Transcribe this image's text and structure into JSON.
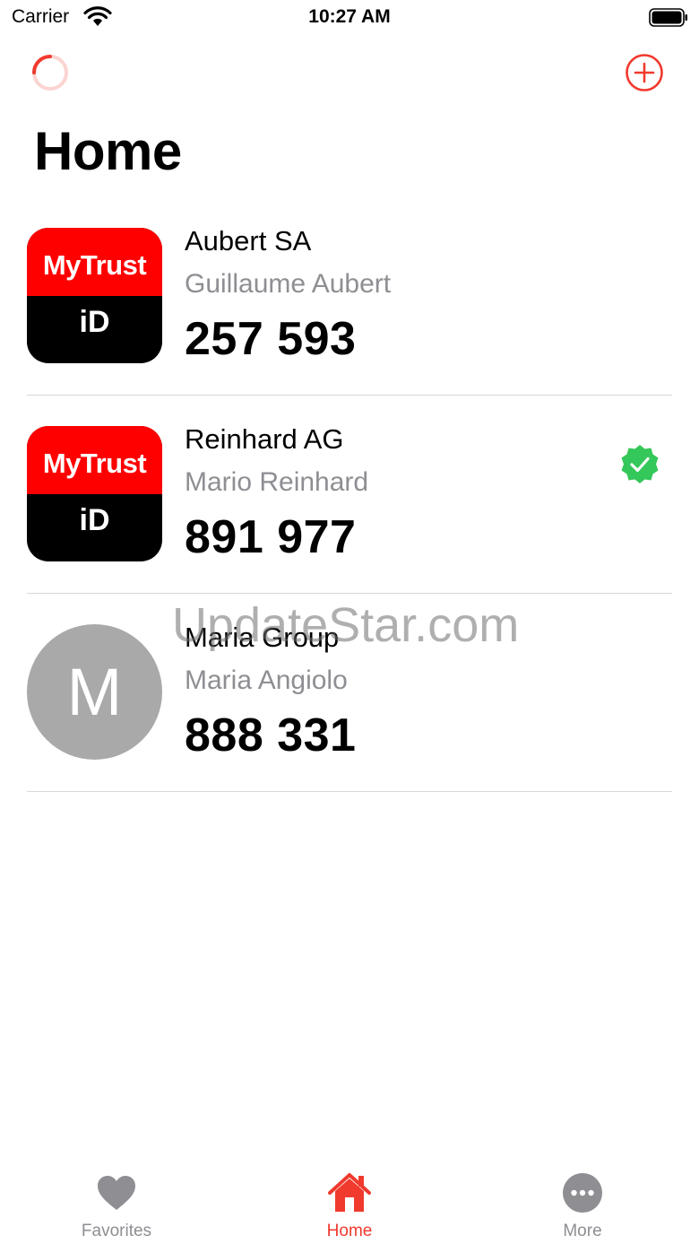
{
  "status_bar": {
    "carrier": "Carrier",
    "time": "10:27 AM"
  },
  "nav": {
    "title": "Home"
  },
  "accounts": [
    {
      "logo_brand": "MyTrust",
      "logo_id": "iD",
      "organization": "Aubert SA",
      "person": "Guillaume Aubert",
      "code": "257 593",
      "verified": false
    },
    {
      "logo_brand": "MyTrust",
      "logo_id": "iD",
      "organization": "Reinhard AG",
      "person": "Mario Reinhard",
      "code": "891 977",
      "verified": true
    },
    {
      "avatar_letter": "M",
      "organization": "Maria Group",
      "person": "Maria Angiolo",
      "code": "888 331",
      "verified": false
    }
  ],
  "watermark": "UpdateStar.com",
  "tabs": [
    {
      "label": "Favorites",
      "icon": "heart-icon",
      "active": false
    },
    {
      "label": "Home",
      "icon": "house-icon",
      "active": true
    },
    {
      "label": "More",
      "icon": "more-icon",
      "active": false
    }
  ],
  "colors": {
    "accent": "#f03a2e",
    "verified": "#34c759",
    "logo_red": "#ff0000",
    "avatar_gray": "#a9a9a9",
    "secondary_text": "#8e8e93"
  }
}
